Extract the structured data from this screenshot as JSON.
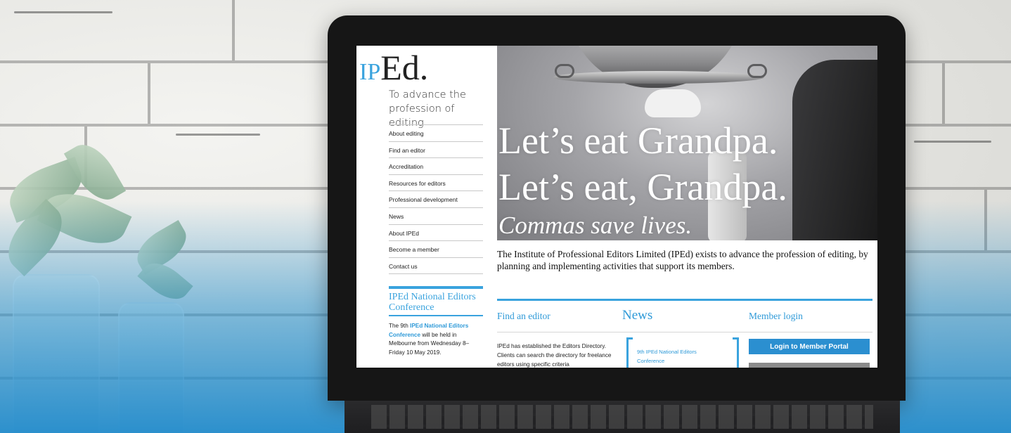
{
  "site": {
    "logo_ip": "IP",
    "logo_ed": "Ed.",
    "tagline": "To advance the profession of editing"
  },
  "nav": {
    "items": [
      {
        "label": "About editing"
      },
      {
        "label": "Find an editor"
      },
      {
        "label": "Accreditation"
      },
      {
        "label": "Resources for editors"
      },
      {
        "label": "Professional development"
      },
      {
        "label": "News"
      },
      {
        "label": "About IPEd"
      },
      {
        "label": "Become a member"
      },
      {
        "label": "Contact us"
      }
    ]
  },
  "conference": {
    "heading": "IPEd National Editors Conference",
    "text_before": "The 9th ",
    "link": "IPEd National Editors Conference",
    "text_after": " will be held in Melbourne from Wednesday 8–Friday 10 May 2019."
  },
  "hero": {
    "line1": "Let’s eat Grandpa.",
    "line2": "Let’s eat, Grandpa.",
    "line3": "Commas save lives."
  },
  "intro": "The Institute of Professional Editors Limited (IPEd) exists to advance the profession of editing, by planning and implementing activities that support its members.",
  "columns": {
    "find": {
      "heading": "Find an editor",
      "text": "IPEd has established the Editors Directory. Clients can search the directory for freelance editors using specific criteria"
    },
    "news": {
      "heading": "News",
      "link": "9th IPEd National Editors Conference"
    },
    "login": {
      "heading": "Member login",
      "button": "Login to Member Portal"
    }
  },
  "colors": {
    "accent": "#3aa3de",
    "button": "#2b8fd0",
    "background_gradient": "#238ccc"
  }
}
